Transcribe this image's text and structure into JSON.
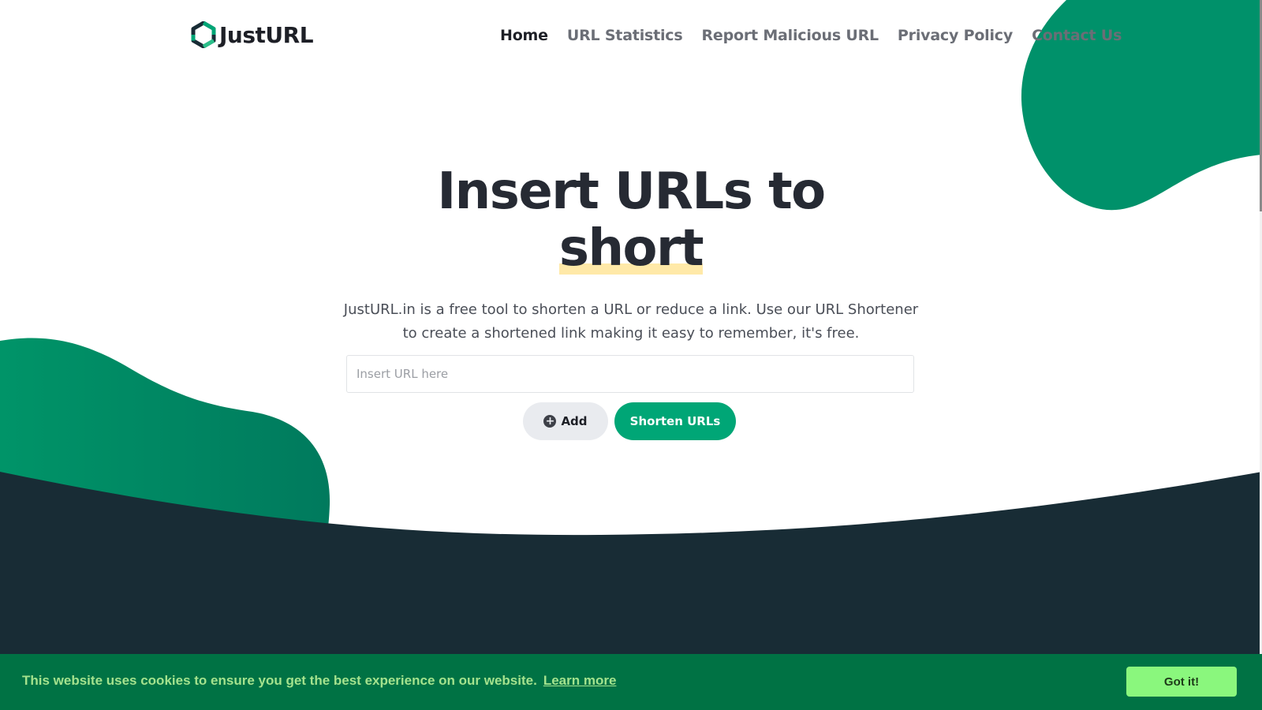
{
  "brand": {
    "name": "JustURL",
    "logo_icon": "hexagon-swirl-icon",
    "accent": "#00a676",
    "dark": "#182c35"
  },
  "nav": {
    "items": [
      {
        "label": "Home",
        "active": true
      },
      {
        "label": "URL Statistics",
        "active": false
      },
      {
        "label": "Report Malicious URL",
        "active": false
      },
      {
        "label": "Privacy Policy",
        "active": false
      },
      {
        "label": "Contact Us",
        "active": false
      }
    ]
  },
  "hero": {
    "title_line1": "Insert URLs to",
    "title_highlight": "short",
    "description": "JustURL.in is a free tool to shorten a URL or reduce a link. Use our URL Shortener to create a shortened link making it easy to remember, it's free.",
    "input_placeholder": "Insert URL here",
    "input_value": "",
    "add_label": "Add",
    "add_icon": "plus-circle-icon",
    "shorten_label": "Shorten URLs"
  },
  "cookie": {
    "message": "This website uses cookies to ensure you get the best experience on our website.",
    "link_label": "Learn more",
    "button_label": "Got it!",
    "background": "#007244",
    "button_color": "#8af77d"
  }
}
